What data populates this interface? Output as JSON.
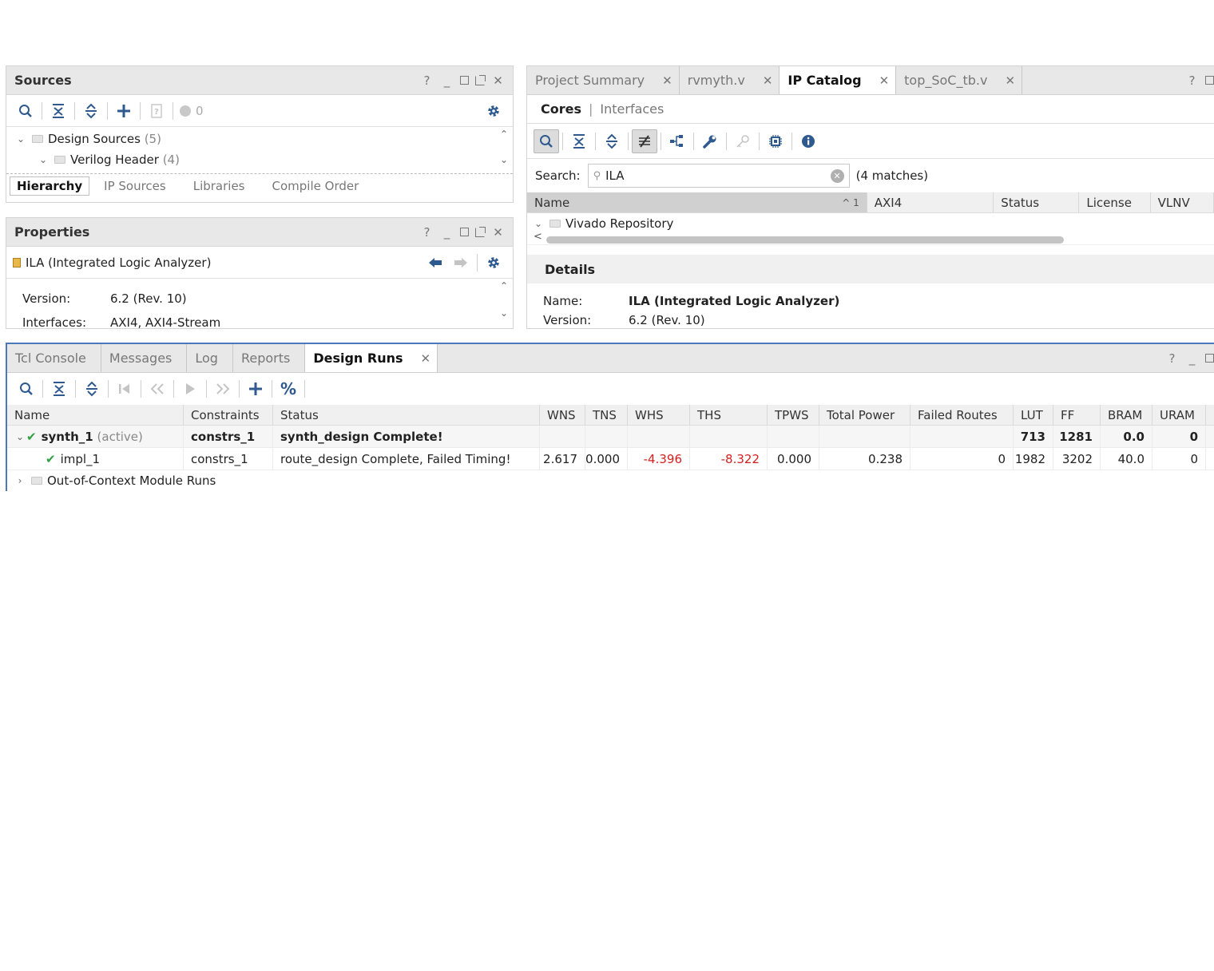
{
  "sources": {
    "title": "Sources",
    "count": "0",
    "tree": [
      {
        "label": "Design Sources",
        "count": "(5)"
      },
      {
        "label": "Verilog Header",
        "count": "(4)"
      }
    ],
    "tabs": [
      "Hierarchy",
      "IP Sources",
      "Libraries",
      "Compile Order"
    ]
  },
  "properties": {
    "title": "Properties",
    "item": "ILA (Integrated Logic Analyzer)",
    "rows": [
      {
        "label": "Version:",
        "value": "6.2 (Rev. 10)"
      },
      {
        "label": "Interfaces:",
        "value": "AXI4, AXI4-Stream"
      }
    ]
  },
  "editor": {
    "tabs": [
      {
        "label": "Project Summary",
        "active": false
      },
      {
        "label": "rvmyth.v",
        "active": false
      },
      {
        "label": "IP Catalog",
        "active": true
      },
      {
        "label": "top_SoC_tb.v",
        "active": false
      }
    ],
    "subtabs": [
      "Cores",
      "Interfaces"
    ],
    "search_label": "Search:",
    "search_value": "ILA",
    "matches": "(4 matches)",
    "columns": [
      "Name",
      "AXI4",
      "Status",
      "License",
      "VLNV"
    ],
    "sort_indicator": "^ 1",
    "repo": "Vivado Repository",
    "details_title": "Details",
    "details": [
      {
        "label": "Name:",
        "value": "ILA (Integrated Logic Analyzer)"
      },
      {
        "label": "Version:",
        "value": "6.2 (Rev. 10)"
      }
    ]
  },
  "runs": {
    "tabs": [
      {
        "label": "Tcl Console",
        "active": false
      },
      {
        "label": "Messages",
        "active": false
      },
      {
        "label": "Log",
        "active": false
      },
      {
        "label": "Reports",
        "active": false
      },
      {
        "label": "Design Runs",
        "active": true
      }
    ],
    "columns": [
      "Name",
      "Constraints",
      "Status",
      "WNS",
      "TNS",
      "WHS",
      "THS",
      "TPWS",
      "Total Power",
      "Failed Routes",
      "LUT",
      "FF",
      "BRAM",
      "URAM"
    ],
    "synth": {
      "name": "synth_1",
      "tag": "(active)",
      "constraints": "constrs_1",
      "status": "synth_design Complete!",
      "lut": "713",
      "ff": "1281",
      "bram": "0.0",
      "uram": "0"
    },
    "impl": {
      "name": "impl_1",
      "constraints": "constrs_1",
      "status": "route_design Complete, Failed Timing!",
      "wns": "2.617",
      "tns": "0.000",
      "whs": "-4.396",
      "ths": "-8.322",
      "tpws": "0.000",
      "power": "0.238",
      "failed": "0",
      "lut": "1982",
      "ff": "3202",
      "bram": "40.0",
      "uram": "0"
    },
    "ooc": "Out-of-Context Module Runs"
  },
  "colors": {
    "accent": "#2f5a8f",
    "error": "#d42020",
    "success": "#2ea043",
    "focus_border": "#4a78b8"
  }
}
